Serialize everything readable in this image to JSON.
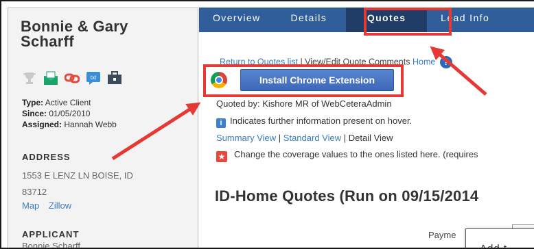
{
  "client": {
    "name": "Bonnie & Gary Scharff",
    "type_label": "Type:",
    "type_value": "Active Client",
    "since_label": "Since:",
    "since_value": "01/05/2010",
    "assigned_label": "Assigned:",
    "assigned_value": "Hannah Webb",
    "icons": [
      "trophy-icon",
      "email-icon",
      "link-icon",
      "text-message-icon",
      "briefcase-icon"
    ]
  },
  "address": {
    "heading": "ADDRESS",
    "line1": "1553 E LENZ LN BOISE, ID",
    "line2": "83712",
    "map_link": "Map",
    "zillow_link": "Zillow"
  },
  "applicant": {
    "heading": "APPLICANT",
    "name": "Bonnie Scharff"
  },
  "tabs": [
    {
      "label": "Overview"
    },
    {
      "label": "Details"
    },
    {
      "label": "Quotes",
      "active": true
    },
    {
      "label": "Lead Info"
    }
  ],
  "quote_page": {
    "return_link": "Return to Quotes list",
    "breadcrumb_text": "View/Edit Quote Comments",
    "home_link": "Home",
    "help": "?",
    "install_button": "Install Chrome Extension",
    "quoted_by": "Quoted by: Kishore MR of WebCeteraAdmin",
    "info_note": "Indicates further information present on hover.",
    "summary_view": "Summary View",
    "standard_view": "Standard View",
    "detail_view": "Detail View",
    "change_note": "Change the coverage values to the ones listed here. (requires",
    "title": "ID-Home Quotes (Run on 09/15/2014",
    "payment_label": "Payme",
    "popup_text": "Add t"
  },
  "colors": {
    "tab_bar": "#2f5e9b",
    "tab_active": "#1f3d66",
    "highlight": "#e53936",
    "link": "#3a7cc2",
    "button": "#3c68b8"
  }
}
